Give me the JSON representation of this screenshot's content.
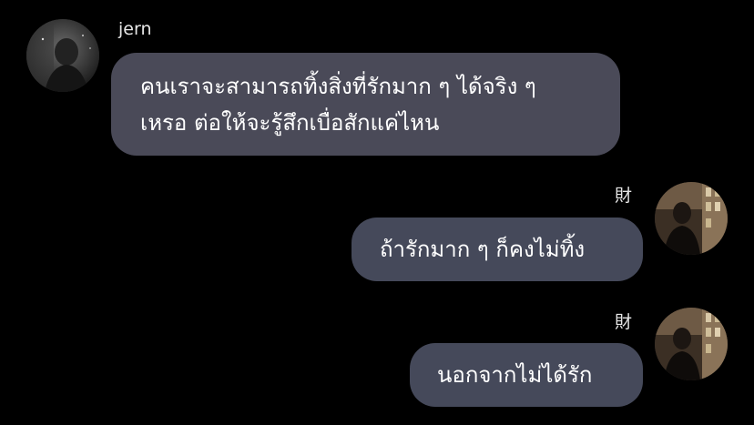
{
  "chat": {
    "messages": [
      {
        "sender": "jern",
        "side": "left",
        "lines": [
          "คนเราจะสามารถทิ้งสิ่งที่รักมาก ๆ ได้จริง ๆ",
          "เหรอ ต่อให้จะรู้สึกเบื่อสักแค่ไหน"
        ]
      },
      {
        "sender": "財",
        "side": "right",
        "lines": [
          "ถ้ารักมาก ๆ ก็คงไม่ทิ้ง"
        ]
      },
      {
        "sender": "財",
        "side": "right",
        "lines": [
          "นอกจากไม่ได้รัก"
        ]
      }
    ]
  },
  "colors": {
    "background": "#000000",
    "bubble": "#4a4a58",
    "text": "#ffffff",
    "name": "#e6e6e6"
  }
}
